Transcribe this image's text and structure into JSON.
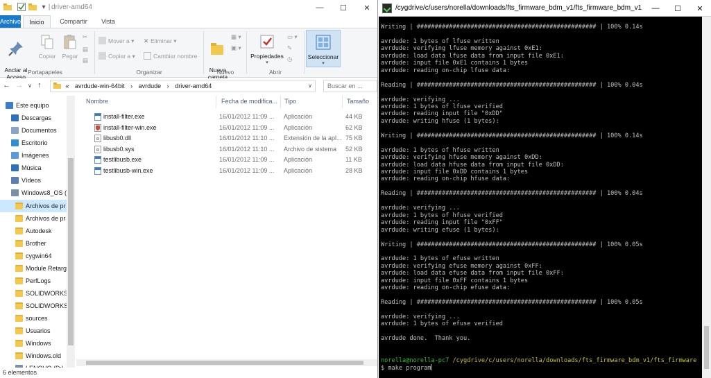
{
  "explorer": {
    "title": "driver-amd64",
    "tabs": [
      "Archivo",
      "Inicio",
      "Compartir",
      "Vista"
    ],
    "ribbon": {
      "pin": "Anclar al\nAcceso rápido",
      "copy": "Copiar",
      "paste": "Pegar",
      "move_to": "Mover a",
      "copy_to": "Copiar a",
      "delete": "Eliminar",
      "rename": "Cambiar nombre",
      "new_folder": "Nueva\ncarpeta",
      "properties": "Propiedades",
      "select": "Seleccionar",
      "groups": [
        "Portapapeles",
        "Organizar",
        "Nuevo",
        "Abrir"
      ]
    },
    "address": {
      "segments": [
        "«",
        "avrdude-win-64bit",
        "›",
        "avrdude",
        "›",
        "driver-amd64"
      ],
      "search_placeholder": "Buscar en ..."
    },
    "nav": [
      "Este equipo",
      "Descargas",
      "Documentos",
      "Escritorio",
      "Imágenes",
      "Música",
      "Vídeos",
      "Windows8_OS (C",
      "Archivos de pr",
      "Archivos de pr",
      "Autodesk",
      "Brother",
      "cygwin64",
      "Module Retarg",
      "PerfLogs",
      "SOLIDWORKS I",
      "SOLIDWORKS I",
      "sources",
      "Usuarios",
      "Windows",
      "Windows.old",
      "LENOVO (D:)"
    ],
    "columns": [
      "Nombre",
      "Fecha de modifica...",
      "Tipo",
      "Tamaño"
    ],
    "files": [
      {
        "name": "install-filter.exe",
        "date": "16/01/2012 11:09 ...",
        "type": "Aplicación",
        "size": "44 KB"
      },
      {
        "name": "install-filter-win.exe",
        "date": "16/01/2012 11:09 ...",
        "type": "Aplicación",
        "size": "62 KB"
      },
      {
        "name": "libusb0.dll",
        "date": "16/01/2012 11:10 ...",
        "type": "Extensión de la apl...",
        "size": "75 KB"
      },
      {
        "name": "libusb0.sys",
        "date": "16/01/2012 11:10 ...",
        "type": "Archivo de sistema",
        "size": "52 KB"
      },
      {
        "name": "testlibusb.exe",
        "date": "16/01/2012 11:09 ...",
        "type": "Aplicación",
        "size": "11 KB"
      },
      {
        "name": "testlibusb-win.exe",
        "date": "16/01/2012 11:09 ...",
        "type": "Aplicación",
        "size": "28 KB"
      }
    ],
    "status": "6 elementos"
  },
  "terminal": {
    "title": "/cygdrive/c/users/norella/downloads/fts_firmware_bdm_v1/fts_firmware_bdm_v1",
    "lines": [
      {
        "t": "Writing | ################################################## | 100% 0.14s",
        "c": ""
      },
      {
        "t": "",
        "c": ""
      },
      {
        "t": "avrdude: 1 bytes of lfuse written",
        "c": ""
      },
      {
        "t": "avrdude: verifying lfuse memory against 0xE1:",
        "c": ""
      },
      {
        "t": "avrdude: load data lfuse data from input file 0xE1:",
        "c": ""
      },
      {
        "t": "avrdude: input file 0xE1 contains 1 bytes",
        "c": ""
      },
      {
        "t": "avrdude: reading on-chip lfuse data:",
        "c": ""
      },
      {
        "t": "",
        "c": ""
      },
      {
        "t": "Reading | ################################################## | 100% 0.04s",
        "c": ""
      },
      {
        "t": "",
        "c": ""
      },
      {
        "t": "avrdude: verifying ...",
        "c": ""
      },
      {
        "t": "avrdude: 1 bytes of lfuse verified",
        "c": ""
      },
      {
        "t": "avrdude: reading input file \"0xDD\"",
        "c": ""
      },
      {
        "t": "avrdude: writing hfuse (1 bytes):",
        "c": ""
      },
      {
        "t": "",
        "c": ""
      },
      {
        "t": "Writing | ################################################## | 100% 0.14s",
        "c": ""
      },
      {
        "t": "",
        "c": ""
      },
      {
        "t": "avrdude: 1 bytes of hfuse written",
        "c": ""
      },
      {
        "t": "avrdude: verifying hfuse memory against 0xDD:",
        "c": ""
      },
      {
        "t": "avrdude: load data hfuse data from input file 0xDD:",
        "c": ""
      },
      {
        "t": "avrdude: input file 0xDD contains 1 bytes",
        "c": ""
      },
      {
        "t": "avrdude: reading on-chip hfuse data:",
        "c": ""
      },
      {
        "t": "",
        "c": ""
      },
      {
        "t": "Reading | ################################################## | 100% 0.04s",
        "c": ""
      },
      {
        "t": "",
        "c": ""
      },
      {
        "t": "avrdude: verifying ...",
        "c": ""
      },
      {
        "t": "avrdude: 1 bytes of hfuse verified",
        "c": ""
      },
      {
        "t": "avrdude: reading input file \"0xFF\"",
        "c": ""
      },
      {
        "t": "avrdude: writing efuse (1 bytes):",
        "c": ""
      },
      {
        "t": "",
        "c": ""
      },
      {
        "t": "Writing | ################################################## | 100% 0.05s",
        "c": ""
      },
      {
        "t": "",
        "c": ""
      },
      {
        "t": "avrdude: 1 bytes of efuse written",
        "c": ""
      },
      {
        "t": "avrdude: verifying efuse memory against 0xFF:",
        "c": ""
      },
      {
        "t": "avrdude: load data efuse data from input file 0xFF:",
        "c": ""
      },
      {
        "t": "avrdude: input file 0xFF contains 1 bytes",
        "c": ""
      },
      {
        "t": "avrdude: reading on-chip efuse data:",
        "c": ""
      },
      {
        "t": "",
        "c": ""
      },
      {
        "t": "Reading | ################################################## | 100% 0.05s",
        "c": ""
      },
      {
        "t": "",
        "c": ""
      },
      {
        "t": "avrdude: verifying ...",
        "c": ""
      },
      {
        "t": "avrdude: 1 bytes of efuse verified",
        "c": ""
      },
      {
        "t": "",
        "c": ""
      },
      {
        "t": "avrdude done.  Thank you.",
        "c": ""
      },
      {
        "t": "",
        "c": ""
      },
      {
        "t": "",
        "c": ""
      }
    ],
    "prompt_user": "norella@norella-pc7",
    "prompt_path": "/cygdrive/c/users/norella/downloads/fts_firmware_bdm_v1/fts_firmware",
    "command": "$ make program"
  }
}
